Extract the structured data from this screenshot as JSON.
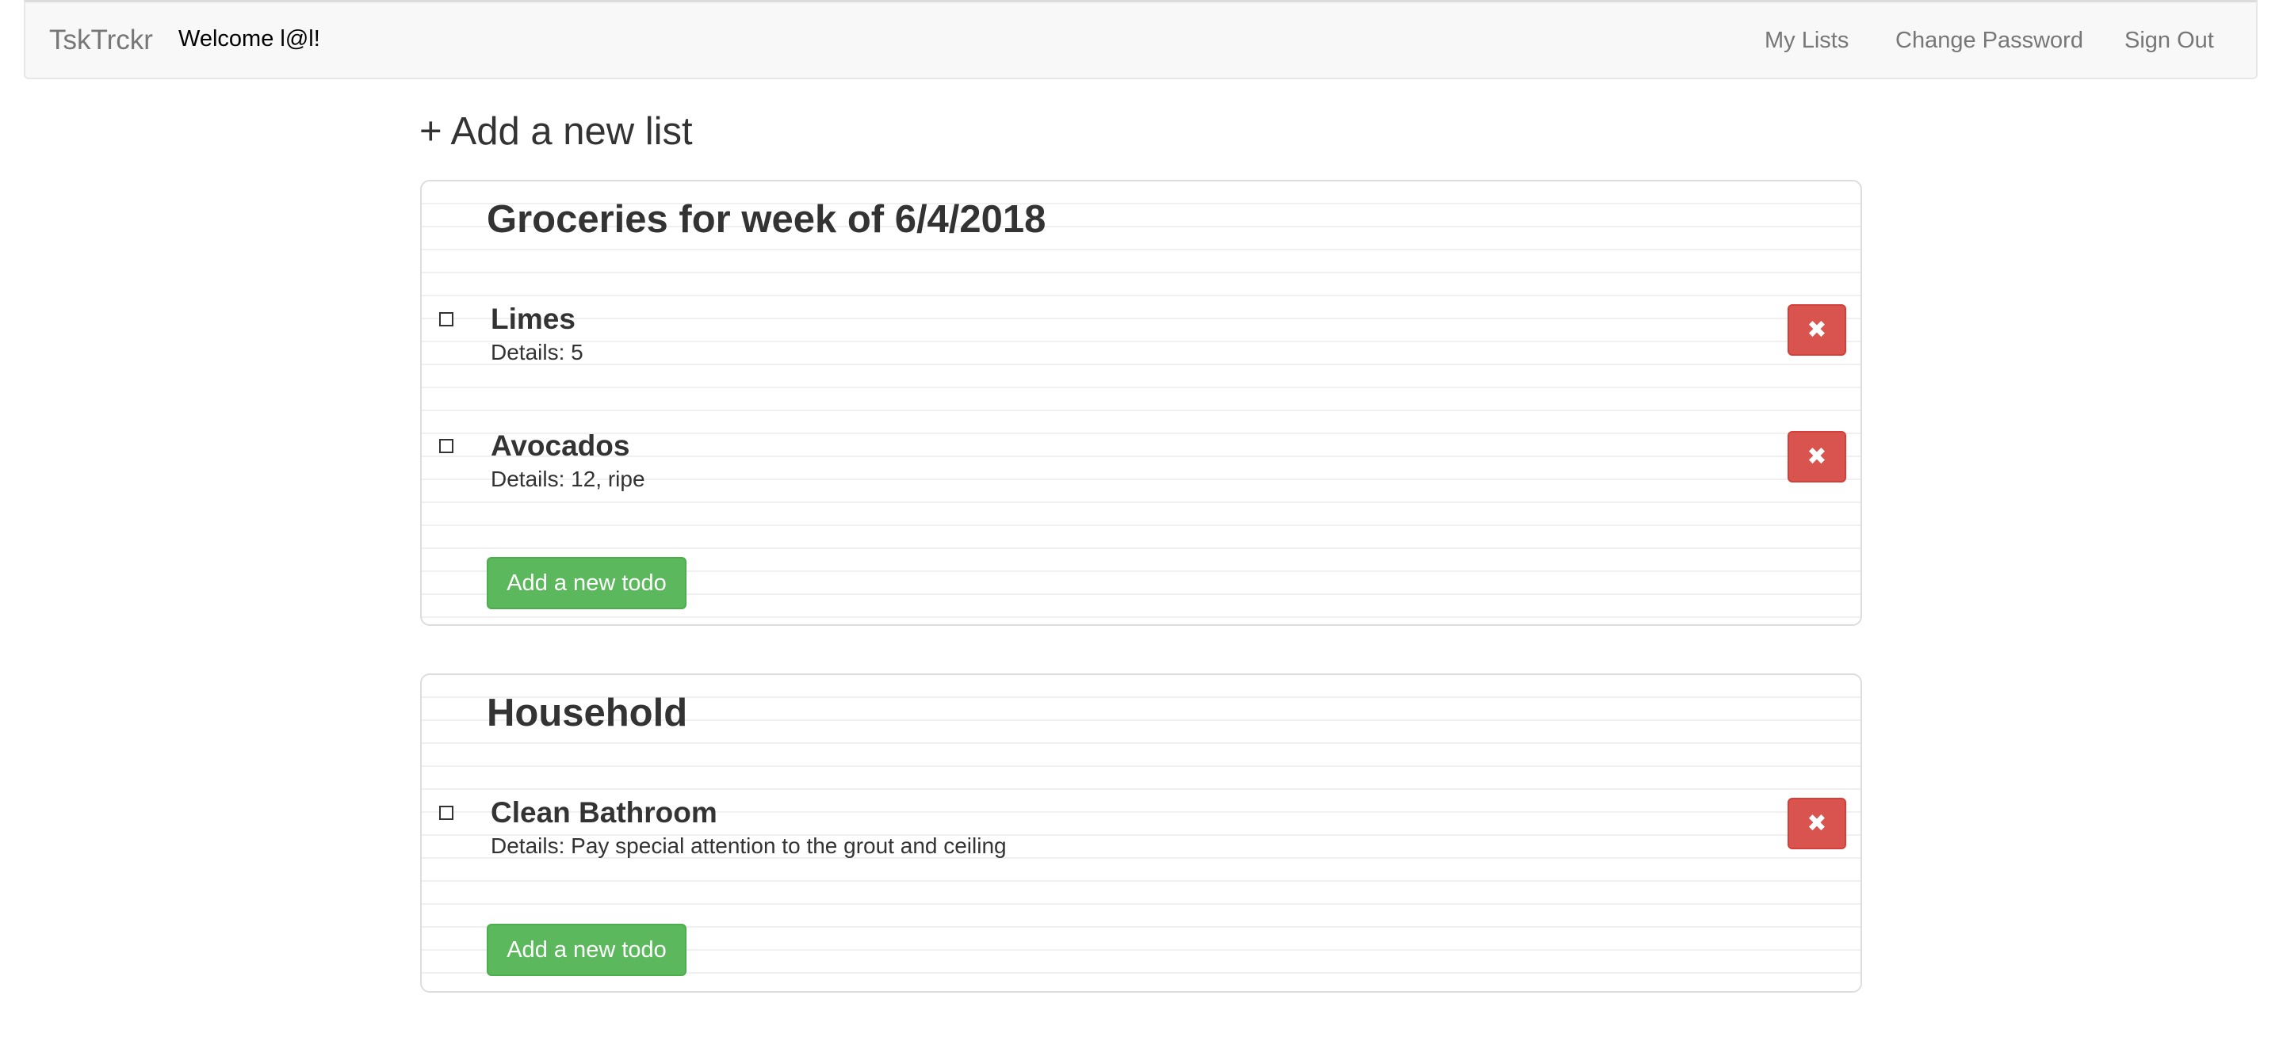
{
  "navbar": {
    "brand": "TskTrckr",
    "welcome": "Welcome l@l!",
    "links": [
      "My Lists",
      "Change Password",
      "Sign Out"
    ]
  },
  "add_list_label": "+ Add a new list",
  "lists": [
    {
      "title": "Groceries for week of 6/4/2018",
      "todos": [
        {
          "name": "Limes",
          "details": "Details: 5"
        },
        {
          "name": "Avocados",
          "details": "Details: 12, ripe"
        }
      ],
      "add_todo_label": "Add a new todo"
    },
    {
      "title": "Household",
      "todos": [
        {
          "name": "Clean Bathroom",
          "details": "Details: Pay special attention to the grout and ceiling"
        }
      ],
      "add_todo_label": "Add a new todo"
    }
  ],
  "icons": {
    "delete": "✖",
    "checkbox": "empty-checkbox"
  },
  "colors": {
    "danger": "#d9534f",
    "success": "#5cb85c",
    "navbar_bg": "#f8f8f8"
  }
}
